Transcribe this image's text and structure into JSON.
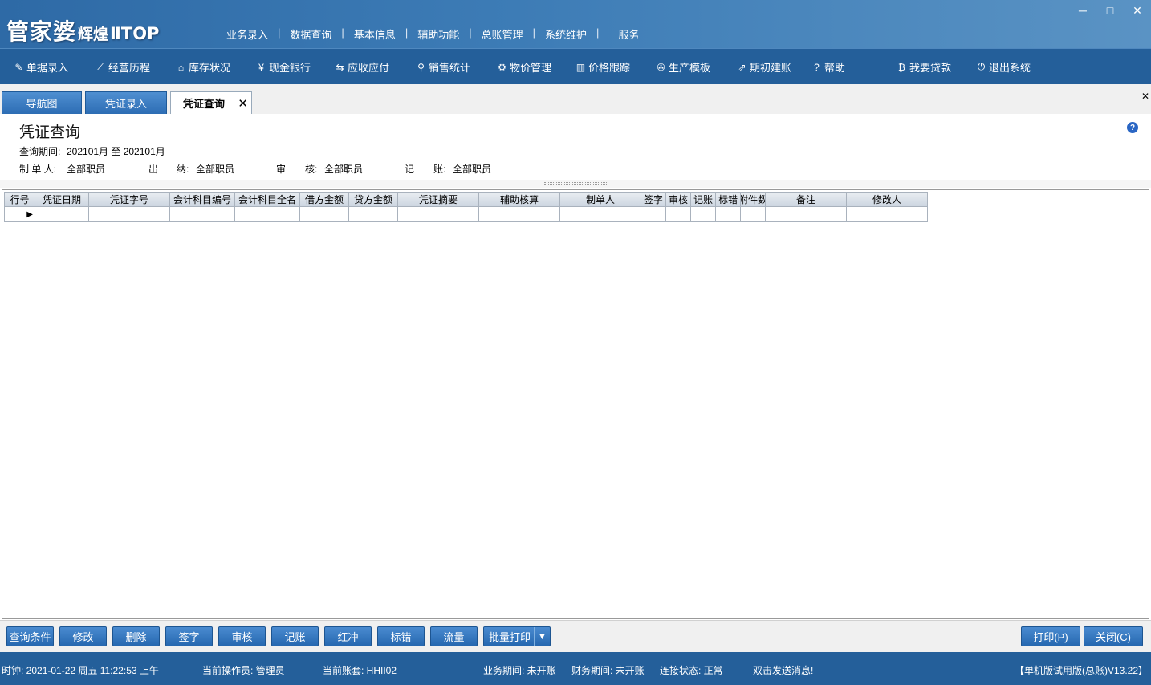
{
  "app": {
    "logo_main": "管家婆",
    "logo_sub": "辉煌",
    "logo_edition": "ⅡTOP",
    "top_menu": [
      "业务录入",
      "数据查询",
      "基本信息",
      "辅助功能",
      "总账管理",
      "系统维护",
      "服务"
    ],
    "window_controls": [
      "─",
      "□",
      "✕"
    ]
  },
  "toolbar": [
    {
      "icon": "document-edit-icon",
      "glyph": "✎",
      "label": "单据录入"
    },
    {
      "icon": "line-chart-icon",
      "glyph": "⟋",
      "label": "经营历程"
    },
    {
      "icon": "warehouse-icon",
      "glyph": "⌂",
      "label": "库存状况"
    },
    {
      "icon": "yen-icon",
      "glyph": "¥",
      "label": "现金银行"
    },
    {
      "icon": "transfer-arrows-icon",
      "glyph": "⇆",
      "label": "应收应付"
    },
    {
      "icon": "search-icon",
      "glyph": "⚲",
      "label": "销售统计"
    },
    {
      "icon": "gear-icon",
      "glyph": "⚙",
      "label": "物价管理"
    },
    {
      "icon": "bar-chart-icon",
      "glyph": "▥",
      "label": "价格跟踪"
    },
    {
      "icon": "wrench-icon",
      "glyph": "✇",
      "label": "生产模板"
    },
    {
      "icon": "external-link-icon",
      "glyph": "⇗",
      "label": "期初建账"
    },
    {
      "icon": "help-question-icon",
      "glyph": "?",
      "label": "帮助"
    },
    {
      "icon": "money-bag-icon",
      "glyph": "₿",
      "label": "我要贷款"
    },
    {
      "icon": "power-icon",
      "glyph": "⏻",
      "label": "退出系统"
    }
  ],
  "tabs": [
    {
      "label": "导航图",
      "active": false
    },
    {
      "label": "凭证录入",
      "active": false
    },
    {
      "label": "凭证查询",
      "active": true,
      "close": "✕"
    }
  ],
  "close_all_glyph": "✕",
  "page": {
    "title": "凭证查询",
    "help_glyph": "?",
    "period_label": "查询期间:",
    "period_value": "202101月 至 202101月",
    "maker_label": "制 单 人:",
    "maker_value": "全部职员",
    "cashier_label_1": "出",
    "cashier_label_2": "纳:",
    "cashier_value": "全部职员",
    "auditor_label_1": "审",
    "auditor_label_2": "核:",
    "auditor_value": "全部职员",
    "poster_label_1": "记",
    "poster_label_2": "账:",
    "poster_value": "全部职员"
  },
  "grid": {
    "columns": [
      "行号",
      "凭证日期",
      "凭证字号",
      "会计科目编号",
      "会计科目全名",
      "借方金额",
      "贷方金额",
      "凭证摘要",
      "辅助核算",
      "制单人",
      "签字",
      "审核",
      "记账",
      "标错",
      "附件数",
      "备注",
      "修改人"
    ],
    "rows": [
      [
        "▶",
        "",
        "",
        "",
        "",
        "",
        "",
        "",
        "",
        "",
        "",
        "",
        "",
        "",
        "",
        "",
        ""
      ]
    ]
  },
  "bottom_buttons": [
    "查询条件",
    "修改",
    "删除",
    "签字",
    "审核",
    "记账",
    "红冲",
    "标错",
    "流量",
    "批量打印"
  ],
  "batch_print_arrow": "▼",
  "right_buttons": [
    "打印(P)",
    "关闭(C)"
  ],
  "status": {
    "clock": "时钟: 2021-01-22 周五 11:22:53 上午",
    "operator": "当前操作员: 管理员",
    "account": "当前账套: HHII02",
    "biz_period": "业务期间: 未开账",
    "fin_period": "财务期间: 未开账",
    "connection": "连接状态: 正常",
    "message": "双击发送消息!",
    "version": "【单机版试用版(总账)V13.22】"
  },
  "colors": {
    "titlebar": "#3d7cb6",
    "toolbar": "#245f9a",
    "button": "#2f73ba",
    "grid_header": "#d9e0e8"
  }
}
